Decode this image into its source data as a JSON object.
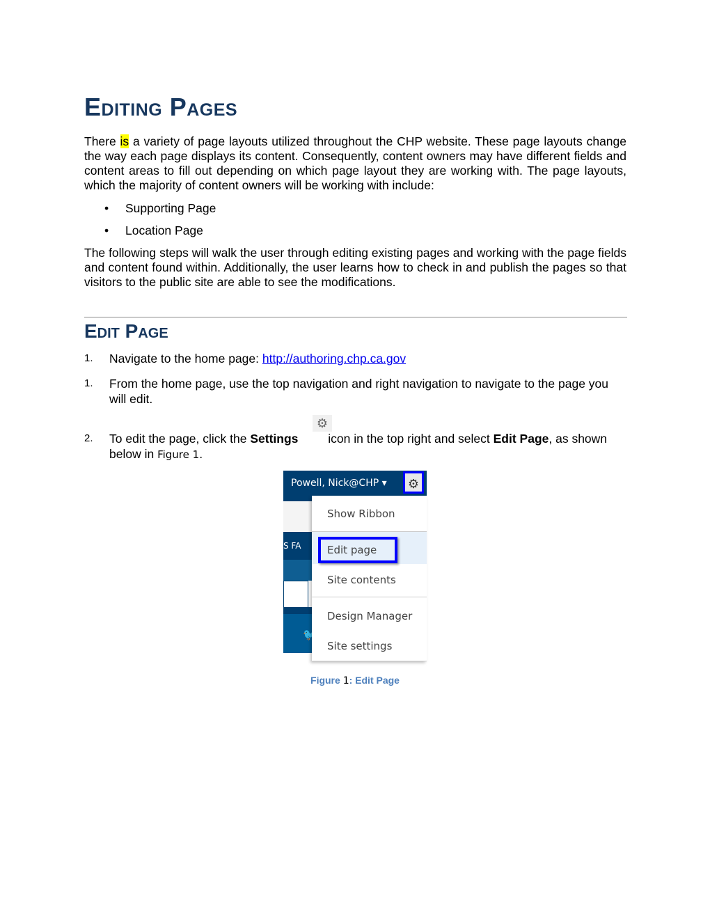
{
  "title": "Editing Pages",
  "intro": {
    "part1": "There ",
    "highlight": "is",
    "part2": " a variety of page layouts utilized throughout the CHP website. These page layouts change the way each page displays its content. Consequently, content owners may have different fields and content areas to fill out depending on which page layout they are working with. The page layouts, which the majority of content owners will be working with include:"
  },
  "bullets": [
    "Supporting Page",
    "Location Page"
  ],
  "paragraph2": "The following steps will walk the user through editing existing pages and working with the page fields and content found within. Additionally, the user learns how to check in and publish the pages so that visitors to the public site are able to see the modifications.",
  "section_title": "Edit Page",
  "steps": [
    {
      "num": "1.",
      "text": "Navigate to the home page: ",
      "link": "http://authoring.chp.ca.gov"
    },
    {
      "num": "1.",
      "text": "From the home page, use the top navigation and right navigation to navigate to the page you will edit."
    },
    {
      "num": "2.",
      "pre": "To edit the page, click the ",
      "bold1": "Settings",
      "mid": " icon in the top right and select ",
      "bold2": "Edit Page",
      "post": ", as shown below in ",
      "ref": "Figure 1",
      "end": "."
    }
  ],
  "figure": {
    "user": "Powell, Nick@CHP ▾",
    "side_text": "S   FA",
    "menu": [
      "Show Ribbon",
      "Edit page",
      "Site contents",
      "Design Manager",
      "Site settings"
    ],
    "caption": {
      "label": "Figure ",
      "num": "1",
      "sep": ": ",
      "title": "Edit Page"
    }
  },
  "colors": {
    "heading": "#17375e",
    "highlight": "#ffff00",
    "nav": "#003e70",
    "outline": "#0000ff"
  }
}
